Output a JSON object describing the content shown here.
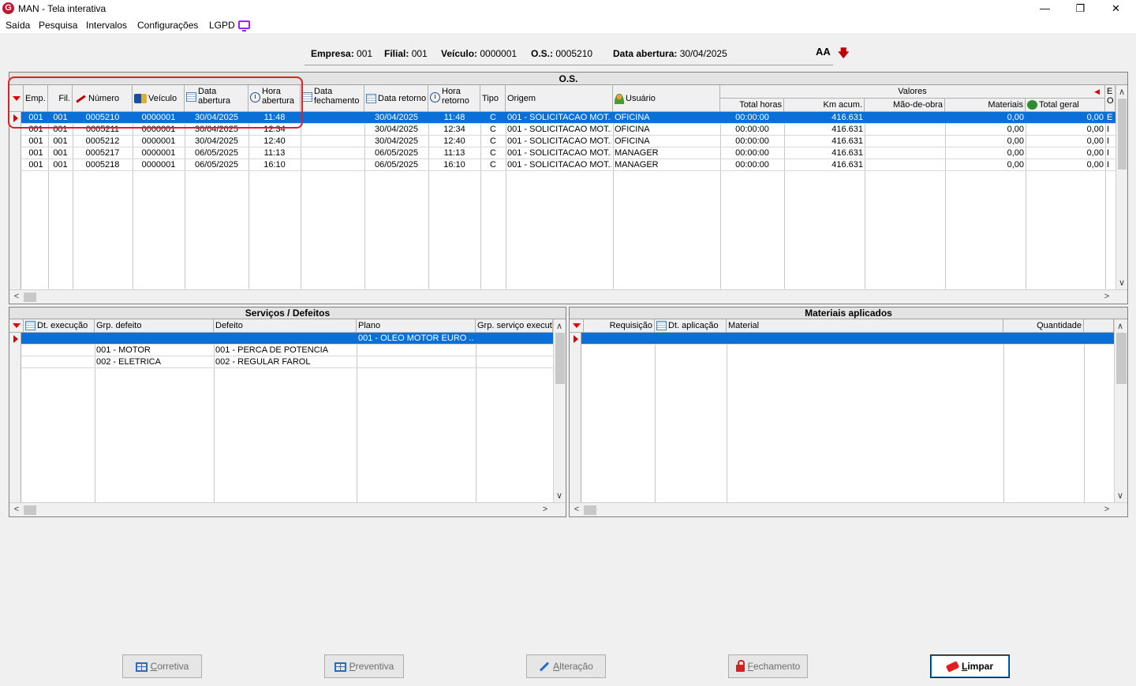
{
  "window": {
    "title": "MAN - Tela interativa",
    "logo": "G",
    "minimize": "—",
    "restore": "❐",
    "close": "✕"
  },
  "menu": [
    "Saída",
    "Pesquisa",
    "Intervalos",
    "Configurações",
    "LGPD"
  ],
  "info": {
    "empresa_label": "Empresa:",
    "empresa": "001",
    "filial_label": "Filial:",
    "filial": "001",
    "veiculo_label": "Veículo:",
    "veiculo": "0000001",
    "os_label": "O.S.:",
    "os": "0005210",
    "data_label": "Data abertura:",
    "data": "30/04/2025",
    "font_icon": "AA"
  },
  "os_grid": {
    "title": "O.S.",
    "headers": {
      "emp": "Emp.",
      "fil": "Fil.",
      "numero": "Número",
      "veiculo": "Veículo",
      "data_abertura_1": "Data",
      "data_abertura_2": "abertura",
      "hora_abertura_1": "Hora",
      "hora_abertura_2": "abertura",
      "data_fechamento_1": "Data",
      "data_fechamento_2": "fechamento",
      "data_retorno": "Data retorno",
      "hora_retorno_1": "Hora",
      "hora_retorno_2": "retorno",
      "tipo": "Tipo",
      "origem": "Origem",
      "usuario": "Usuário",
      "valores": "Valores",
      "total_horas": "Total horas",
      "km_acum": "Km acum.",
      "mao_de_obra": "Mão-de-obra",
      "materiais": "Materiais",
      "total_geral": "Total geral",
      "extra_1": "E",
      "extra_2": "O"
    },
    "rows": [
      {
        "emp": "001",
        "fil": "001",
        "numero": "0005210",
        "veiculo": "0000001",
        "data_ab": "30/04/2025",
        "hora_ab": "11:48",
        "data_fech": "",
        "data_ret": "30/04/2025",
        "hora_ret": "11:48",
        "tipo": "C",
        "origem": "001 - SOLICITACAO MOT...",
        "usuario": "OFICINA",
        "total_horas": "00:00:00",
        "km": "416.631",
        "mao": "",
        "mat": "0,00",
        "total": "0,00",
        "extra": "E"
      },
      {
        "emp": "001",
        "fil": "001",
        "numero": "0005211",
        "veiculo": "0000001",
        "data_ab": "30/04/2025",
        "hora_ab": "12:34",
        "data_fech": "",
        "data_ret": "30/04/2025",
        "hora_ret": "12:34",
        "tipo": "C",
        "origem": "001 - SOLICITACAO MOT...",
        "usuario": "OFICINA",
        "total_horas": "00:00:00",
        "km": "416.631",
        "mao": "",
        "mat": "0,00",
        "total": "0,00",
        "extra": "I"
      },
      {
        "emp": "001",
        "fil": "001",
        "numero": "0005212",
        "veiculo": "0000001",
        "data_ab": "30/04/2025",
        "hora_ab": "12:40",
        "data_fech": "",
        "data_ret": "30/04/2025",
        "hora_ret": "12:40",
        "tipo": "C",
        "origem": "001 - SOLICITACAO MOT...",
        "usuario": "OFICINA",
        "total_horas": "00:00:00",
        "km": "416.631",
        "mao": "",
        "mat": "0,00",
        "total": "0,00",
        "extra": "I"
      },
      {
        "emp": "001",
        "fil": "001",
        "numero": "0005217",
        "veiculo": "0000001",
        "data_ab": "06/05/2025",
        "hora_ab": "11:13",
        "data_fech": "",
        "data_ret": "06/05/2025",
        "hora_ret": "11:13",
        "tipo": "C",
        "origem": "001 - SOLICITACAO MOT...",
        "usuario": "MANAGER",
        "total_horas": "00:00:00",
        "km": "416.631",
        "mao": "",
        "mat": "0,00",
        "total": "0,00",
        "extra": "I"
      },
      {
        "emp": "001",
        "fil": "001",
        "numero": "0005218",
        "veiculo": "0000001",
        "data_ab": "06/05/2025",
        "hora_ab": "16:10",
        "data_fech": "",
        "data_ret": "06/05/2025",
        "hora_ret": "16:10",
        "tipo": "C",
        "origem": "001 - SOLICITACAO MOT...",
        "usuario": "MANAGER",
        "total_horas": "00:00:00",
        "km": "416.631",
        "mao": "",
        "mat": "0,00",
        "total": "0,00",
        "extra": "I"
      }
    ]
  },
  "servicos_grid": {
    "title": "Serviços / Defeitos",
    "headers": {
      "dt_execucao": "Dt. execução",
      "grp_defeito": "Grp. defeito",
      "defeito": "Defeito",
      "plano": "Plano",
      "grp_servico": "Grp. serviço executado"
    },
    "rows": [
      {
        "dt": "",
        "grp": "",
        "defeito": "",
        "plano": "001 - OLEO MOTOR EURO ...",
        "grp_serv": ""
      },
      {
        "dt": "",
        "grp": "001 - MOTOR",
        "defeito": "001 - PERCA DE POTENCIA",
        "plano": "",
        "grp_serv": ""
      },
      {
        "dt": "",
        "grp": "002 - ELETRICA",
        "defeito": "002 - REGULAR FAROL",
        "plano": "",
        "grp_serv": ""
      }
    ]
  },
  "materiais_grid": {
    "title": "Materiais aplicados",
    "headers": {
      "requisicao": "Requisição",
      "dt_aplicacao": "Dt. aplicação",
      "material": "Material",
      "quantidade": "Quantidade"
    }
  },
  "buttons": {
    "corretiva": {
      "first": "C",
      "rest": "orretiva"
    },
    "preventiva": {
      "first": "P",
      "rest": "reventiva"
    },
    "alteracao": {
      "first": "A",
      "rest": "lteração"
    },
    "fechamento": {
      "first": "F",
      "rest": "echamento"
    },
    "limpar": {
      "first": "L",
      "rest": "impar"
    }
  },
  "scroll": {
    "up": "∧",
    "down": "∨",
    "left": "<",
    "right": ">"
  },
  "colors": {
    "selection": "#0a70d8",
    "indicator": "#e00000",
    "highlight": "#e02020"
  }
}
